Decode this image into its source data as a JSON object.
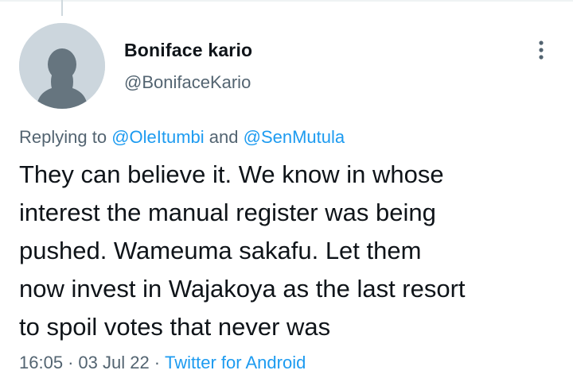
{
  "tweet": {
    "author": {
      "display_name": "Boniface kario",
      "handle": "@BonifaceKario",
      "avatar_icon": "default-profile-avatar-icon"
    },
    "more_icon": "more-vertical-icon",
    "reply": {
      "prefix": "Replying to ",
      "mention_1": "@OleItumbi",
      "joiner": " and ",
      "mention_2": "@SenMutula"
    },
    "text_lines": [
      "They can believe it. We know in whose",
      "interest the manual register was being",
      "pushed. Wameuma sakafu. Let them",
      "now invest in Wajakoya as the last resort",
      "to spoil votes that never was"
    ],
    "meta": {
      "time": "16:05",
      "separator_1": "·",
      "date": "03 Jul 22",
      "separator_2": "·",
      "source": "Twitter for Android"
    },
    "colors": {
      "link": "#1d9bf0",
      "secondary_text": "#536471",
      "primary_text": "#0f1419",
      "avatar_bg": "#ccd6dd"
    }
  }
}
